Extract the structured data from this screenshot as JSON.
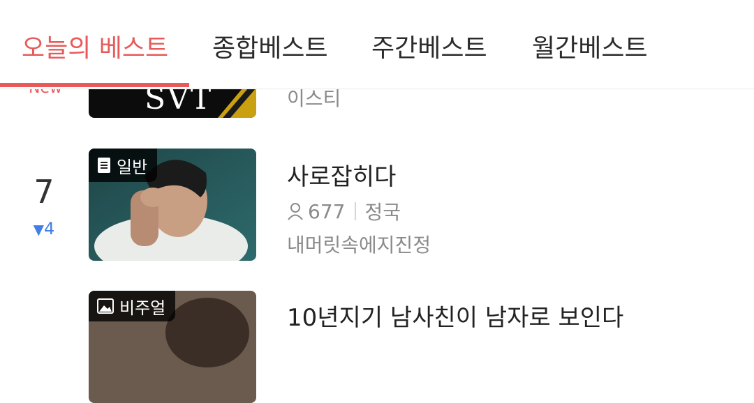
{
  "tabs": [
    {
      "label": "오늘의 베스트",
      "active": true
    },
    {
      "label": "종합베스트",
      "active": false
    },
    {
      "label": "주간베스트",
      "active": false
    },
    {
      "label": "월간베스트",
      "active": false
    }
  ],
  "colors": {
    "accent": "#e85a5a",
    "rank_down": "#3f7fe6",
    "meta_text": "#8a8a8a"
  },
  "items": [
    {
      "status": "New",
      "thumb_text": "SVT",
      "artist": "이스티"
    },
    {
      "rank": "7",
      "change_arrow": "▼",
      "change_value": "4",
      "badge": "일반",
      "badge_icon": "document-icon",
      "title": "사로잡히다",
      "views": "677",
      "author": "정국",
      "artist": "내머릿속에지진정"
    },
    {
      "badge": "비주얼",
      "badge_icon": "image-icon",
      "title": "10년지기 남사친이 남자로 보인다"
    }
  ]
}
